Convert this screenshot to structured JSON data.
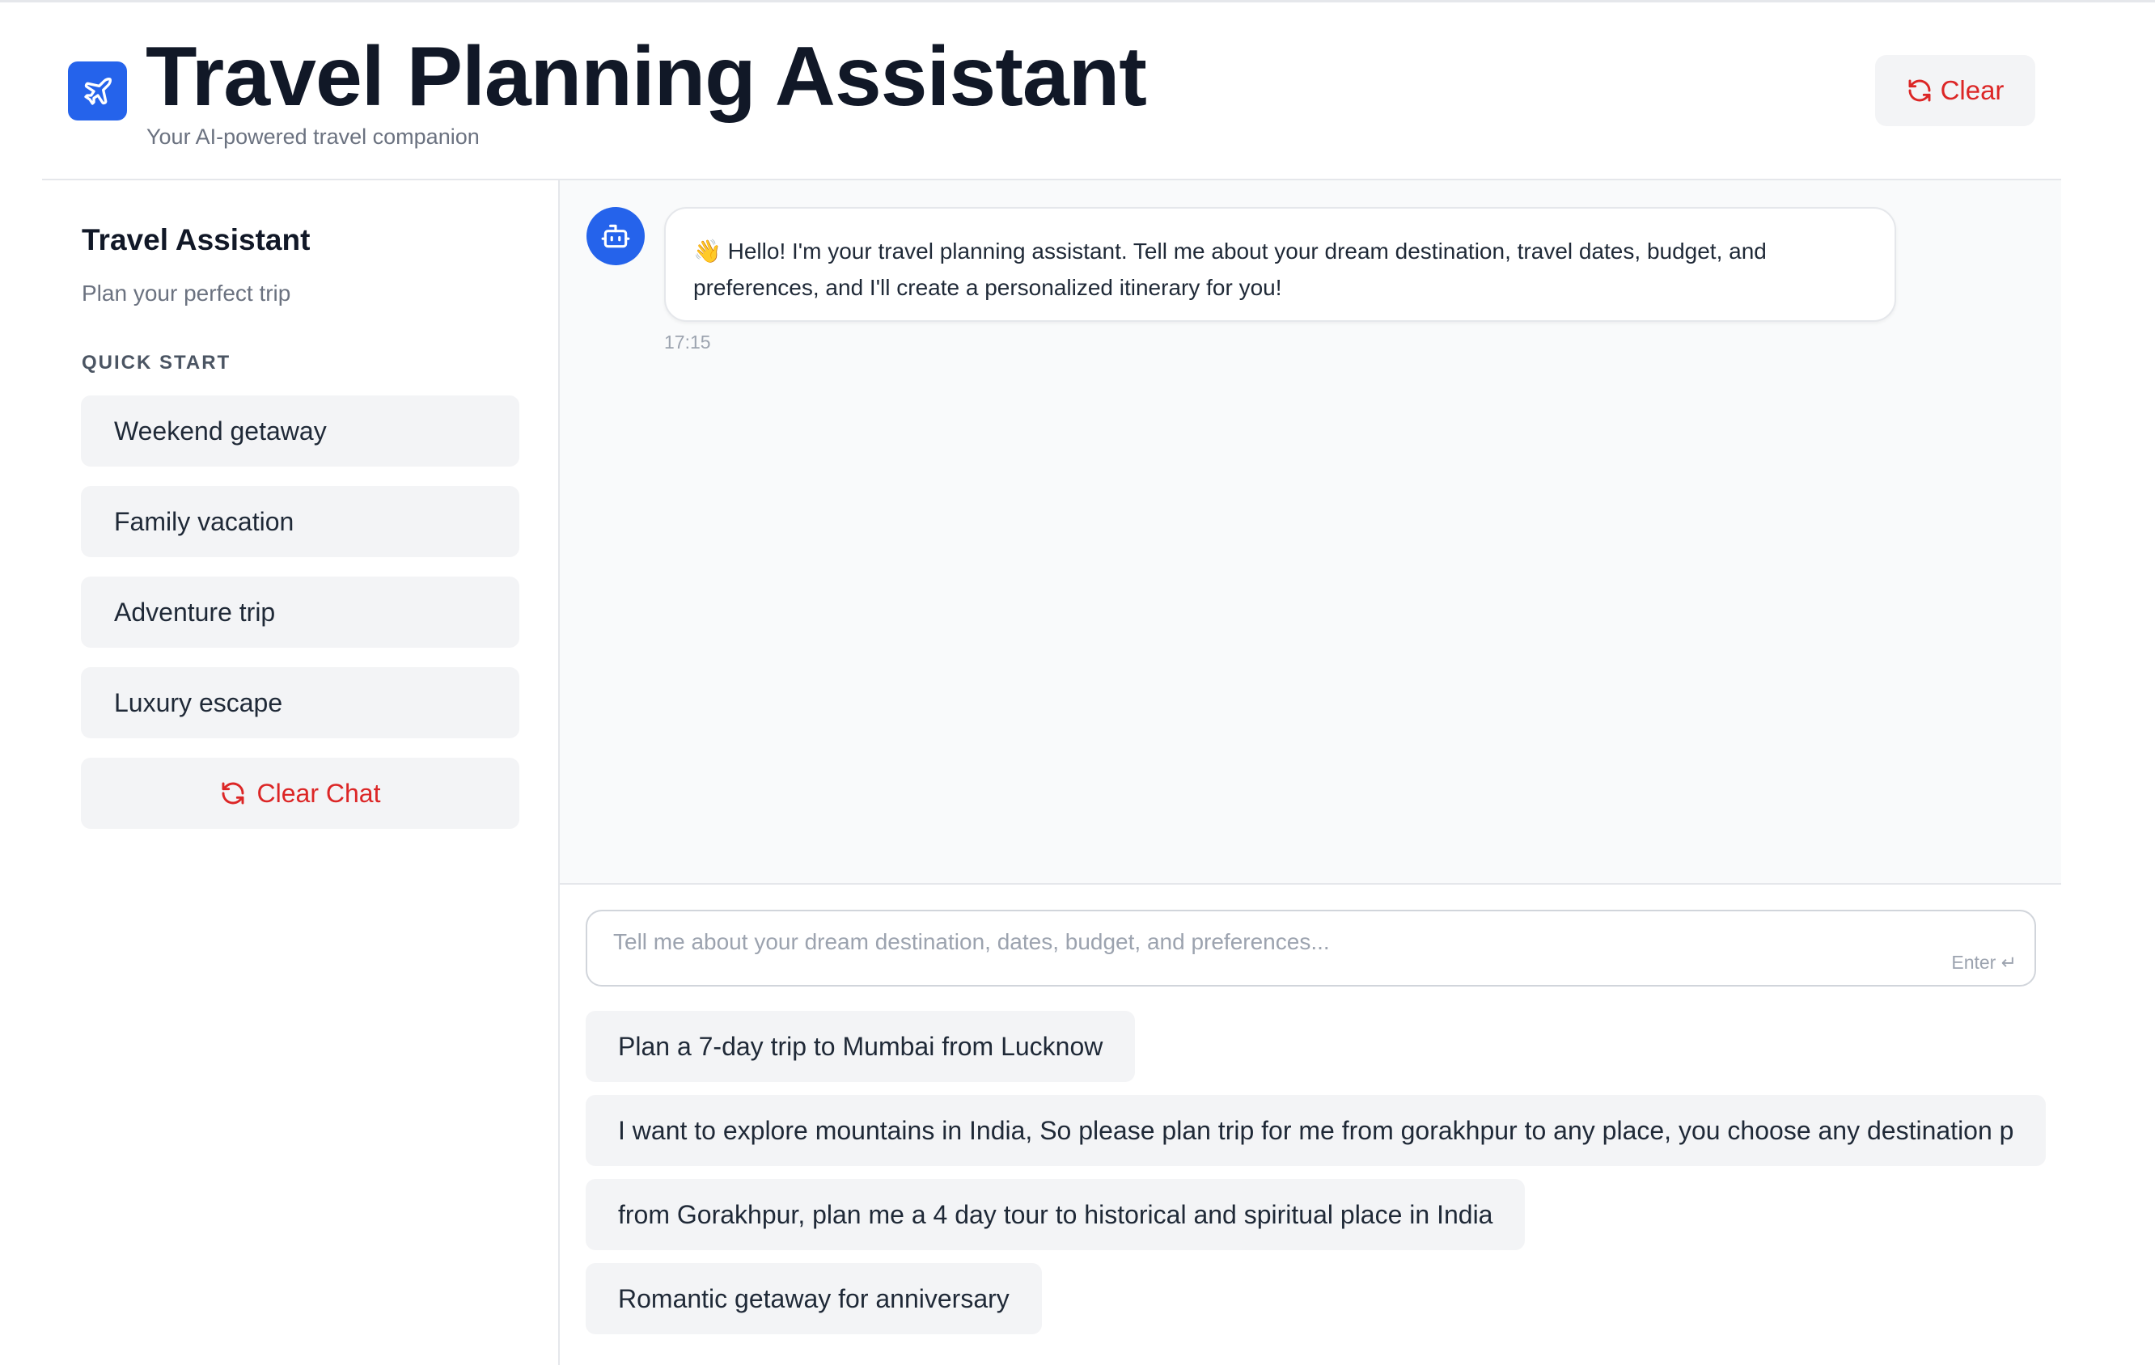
{
  "header": {
    "title": "Travel Planning Assistant",
    "subtitle": "Your AI-powered travel companion",
    "logo_icon": "airplane-icon",
    "clear_label": "Clear",
    "clear_icon": "refresh-icon"
  },
  "sidebar": {
    "title": "Travel Assistant",
    "subtitle": "Plan your perfect trip",
    "section_label": "QUICK START",
    "quick_start": [
      {
        "label": "Weekend getaway"
      },
      {
        "label": "Family vacation"
      },
      {
        "label": "Adventure trip"
      },
      {
        "label": "Luxury escape"
      }
    ],
    "clear_chat_label": "Clear Chat",
    "clear_chat_icon": "refresh-icon"
  },
  "chat": {
    "messages": [
      {
        "sender": "assistant",
        "avatar_icon": "robot-icon",
        "text": "👋 Hello! I'm your travel planning assistant. Tell me about your dream destination, travel dates, budget, and preferences, and I'll create a personalized itinerary for you!",
        "time": "17:15"
      }
    ]
  },
  "input": {
    "placeholder": "Tell me about your dream destination, dates, budget, and preferences...",
    "value": "",
    "hint": "Enter ↵"
  },
  "suggestions": [
    {
      "label": "Plan a 7-day trip to Mumbai from Lucknow"
    },
    {
      "label": "I want to explore mountains in India, So please plan trip for me from gorakhpur to any place, you choose any destination p"
    },
    {
      "label": "from Gorakhpur, plan me a 4 day tour to historical and spiritual place in India"
    },
    {
      "label": "Romantic getaway for anniversary"
    }
  ],
  "colors": {
    "accent": "#2563eb",
    "danger": "#dc2626",
    "button_bg": "#f3f4f6",
    "chat_bg": "#f9fafb"
  }
}
